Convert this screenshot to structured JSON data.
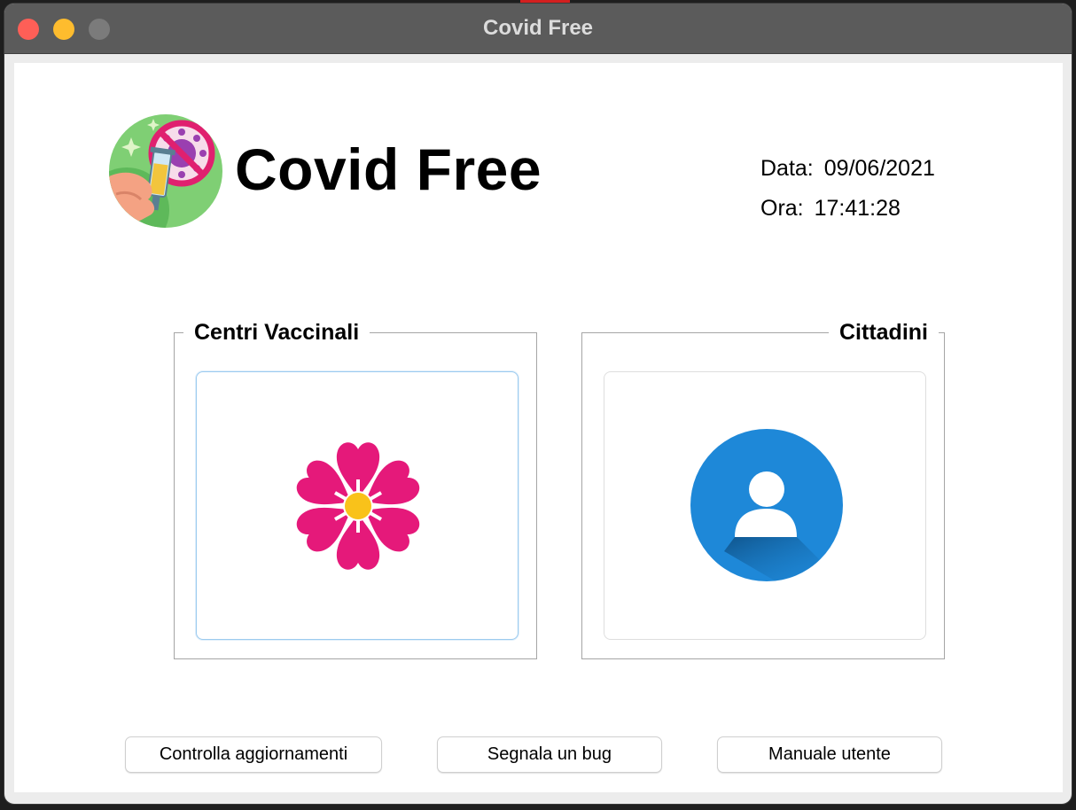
{
  "window": {
    "title": "Covid Free"
  },
  "header": {
    "app_name": "Covid Free",
    "date_label": "Data:",
    "date_value": "09/06/2021",
    "time_label": "Ora:",
    "time_value": "17:41:28"
  },
  "sections": {
    "centri": {
      "title": "Centri Vaccinali",
      "icon": "flower-icon"
    },
    "cittadini": {
      "title": "Cittadini",
      "icon": "user-icon"
    }
  },
  "buttons": {
    "check_updates": "Controlla aggiornamenti",
    "report_bug": "Segnala un bug",
    "user_manual": "Manuale utente"
  },
  "colors": {
    "flower": "#e5197a",
    "flower_center": "#f9c21a",
    "user_circle": "#1e88d8",
    "focus_border": "#9ccbef"
  }
}
